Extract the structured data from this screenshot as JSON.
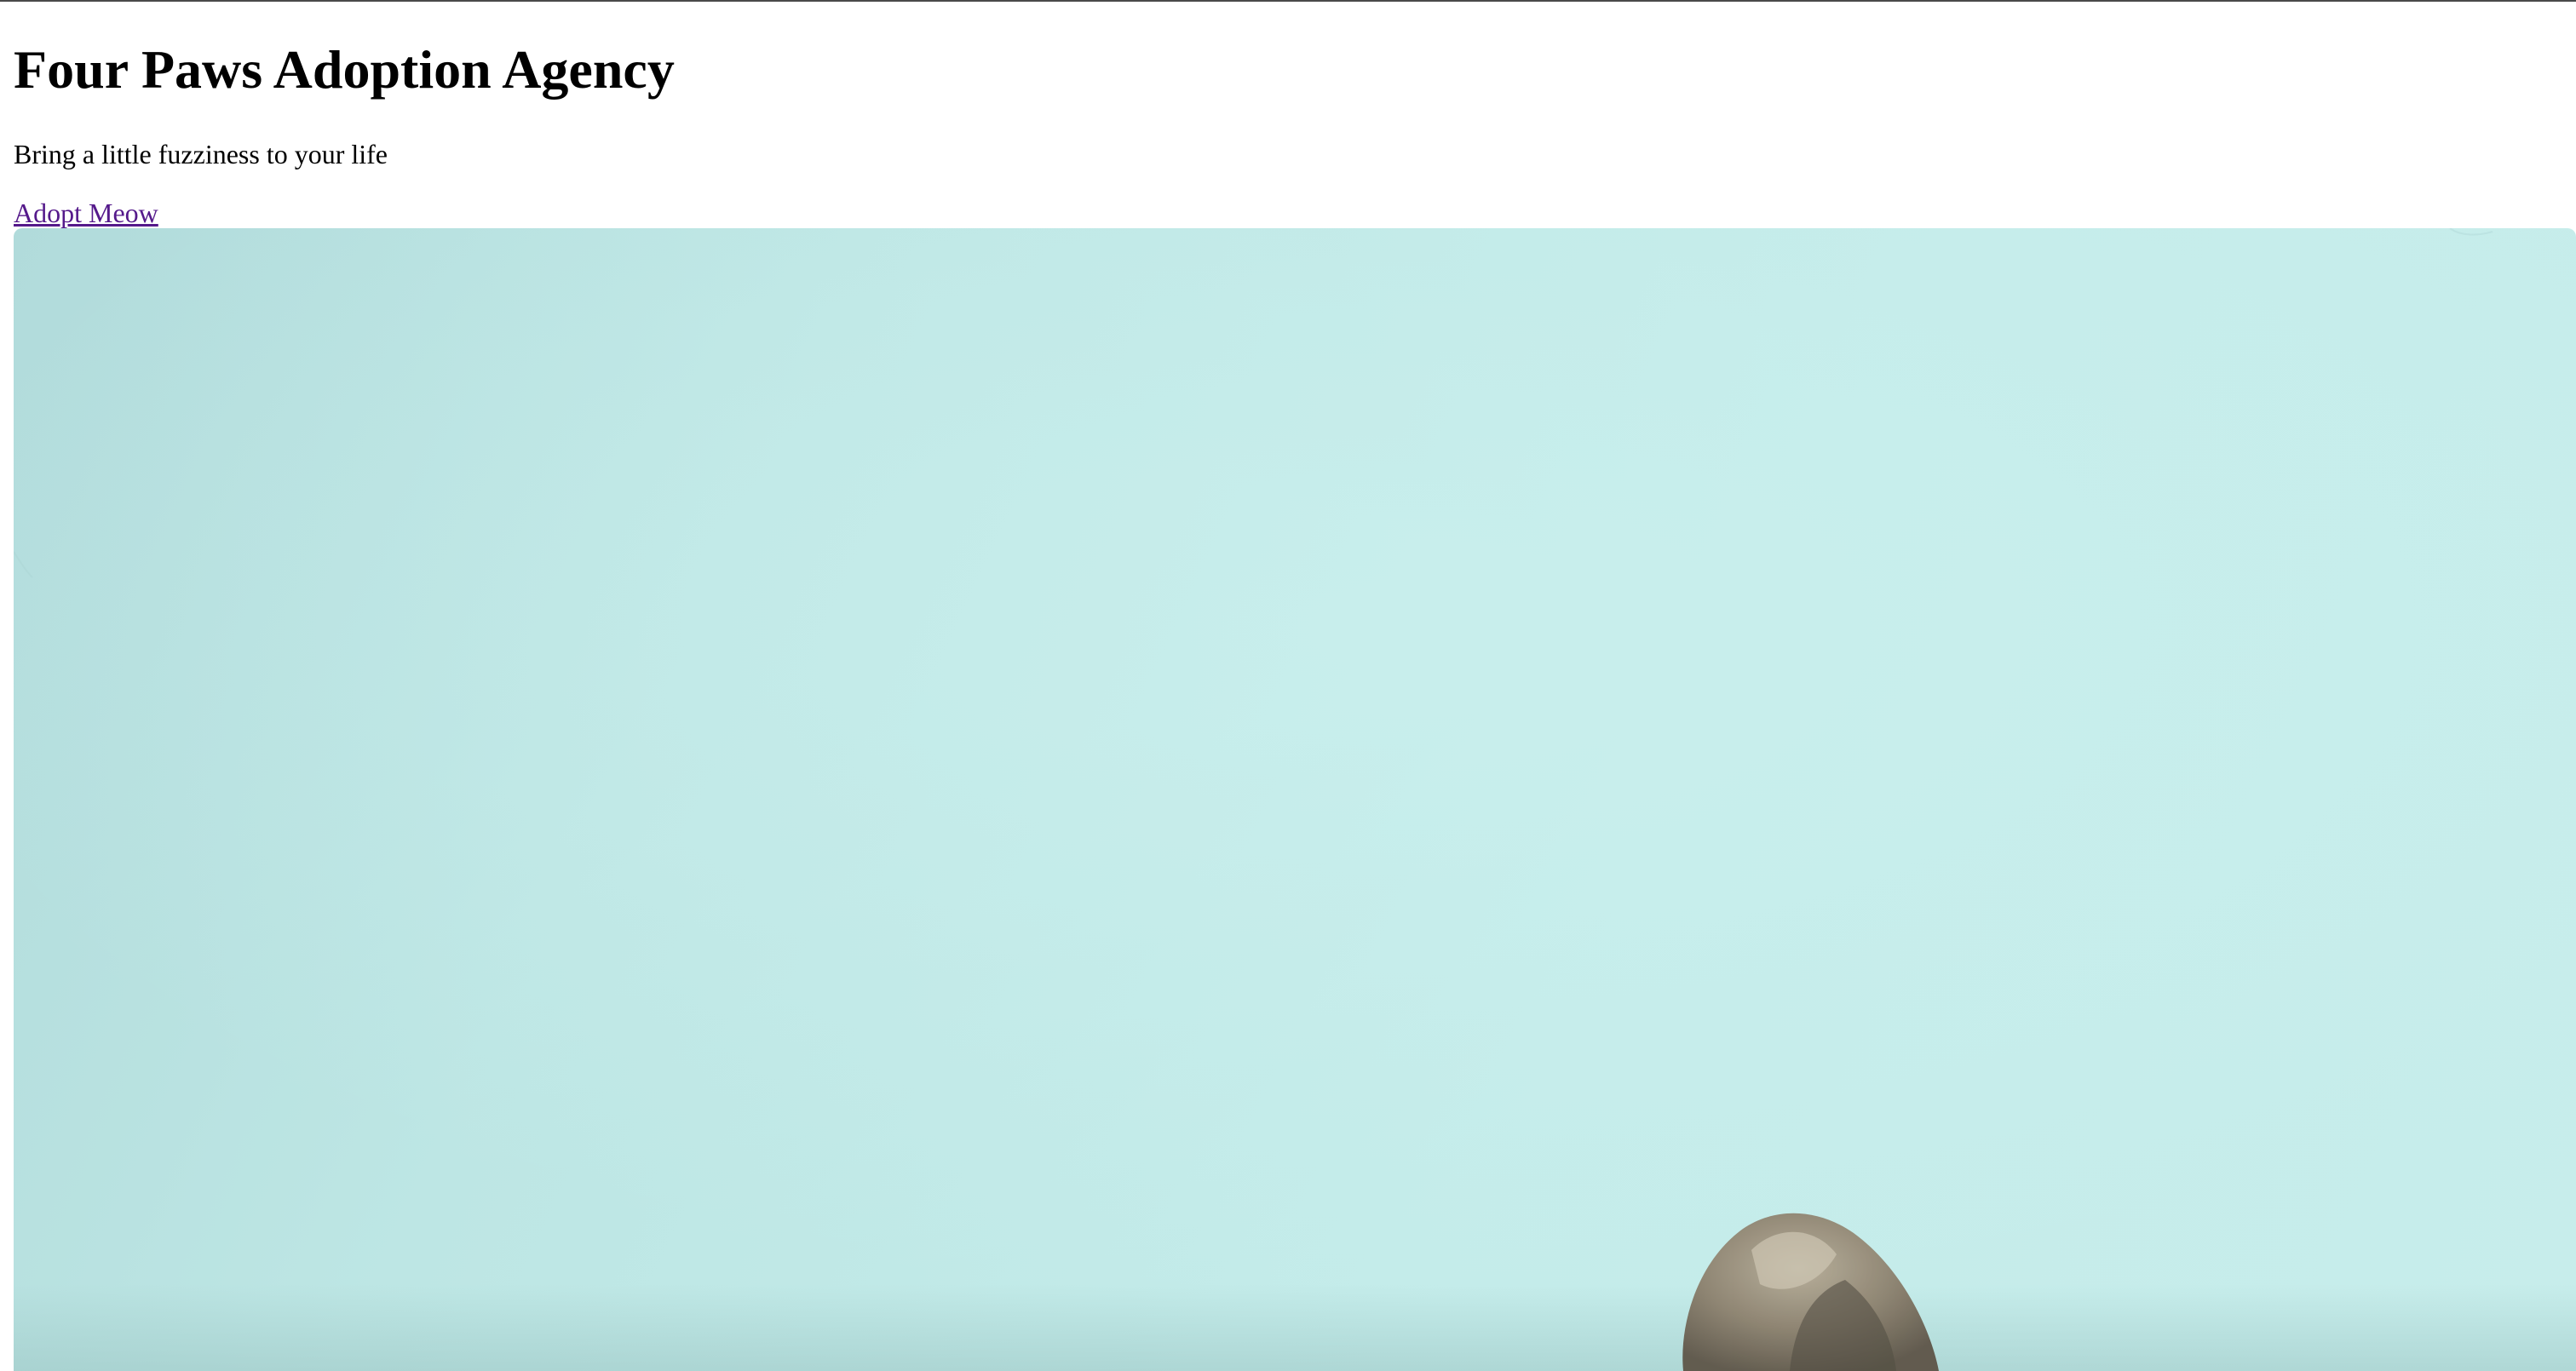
{
  "header": {
    "title": "Four Paws Adoption Agency",
    "tagline": "Bring a little fuzziness to your life",
    "cta_label": "Adopt Meow"
  },
  "hero": {
    "image_subject": "cat-tail-tip on light teal background",
    "background_color": "#c4ecea",
    "link_color": "#551a8b"
  }
}
